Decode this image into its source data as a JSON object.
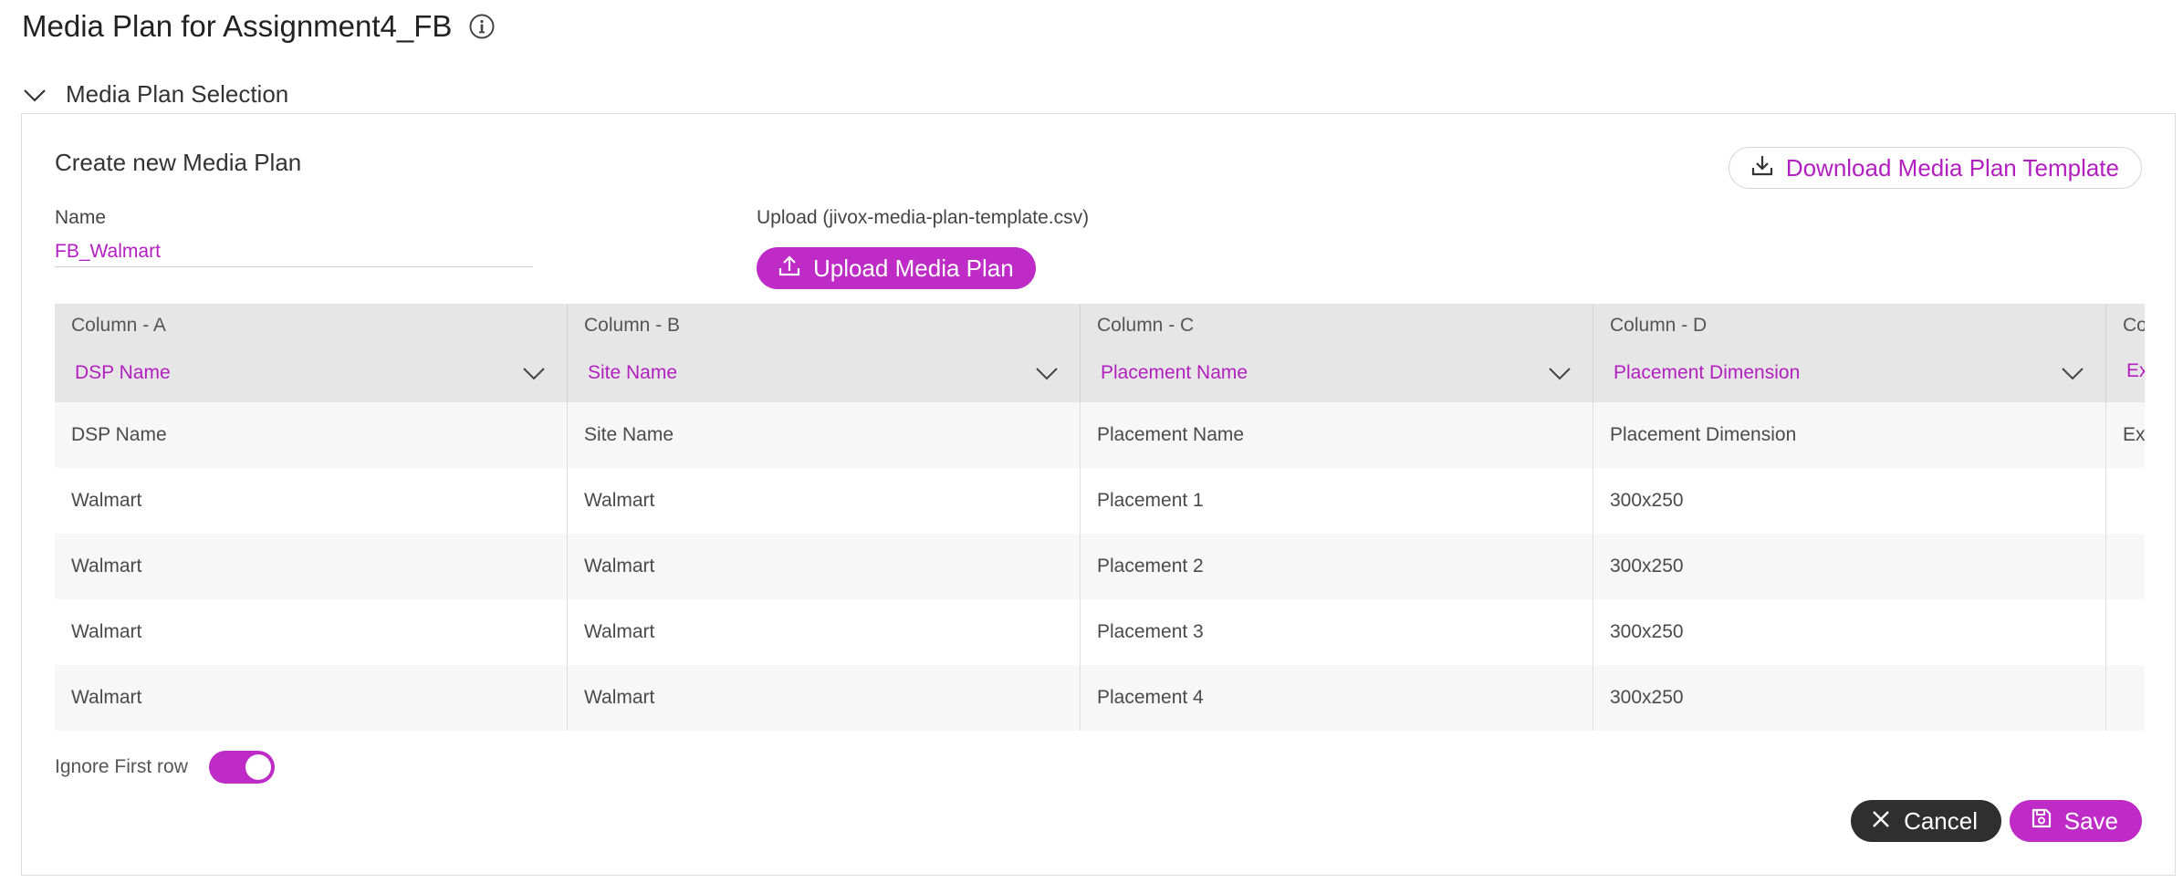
{
  "page": {
    "title": "Media Plan for Assignment4_FB",
    "info_icon": "info-icon"
  },
  "section": {
    "label": "Media Plan Selection",
    "toggle_icon": "chevron-down-icon"
  },
  "panel": {
    "create_title": "Create new Media Plan",
    "download_label": "Download Media Plan Template",
    "name_label": "Name",
    "name_value": "FB_Walmart",
    "upload_label": "Upload (jivox-media-plan-template.csv)",
    "upload_button": "Upload Media Plan"
  },
  "table": {
    "columns": [
      {
        "label": "Column - A",
        "selected": "DSP Name"
      },
      {
        "label": "Column - B",
        "selected": "Site Name"
      },
      {
        "label": "Column - C",
        "selected": "Placement Name"
      },
      {
        "label": "Column - D",
        "selected": "Placement Dimension"
      },
      {
        "label": "Co",
        "selected": "Ex"
      }
    ],
    "rows": [
      [
        "DSP Name",
        "Site Name",
        "Placement Name",
        "Placement Dimension",
        "Ext"
      ],
      [
        "Walmart",
        "Walmart",
        "Placement 1",
        "300x250",
        ""
      ],
      [
        "Walmart",
        "Walmart",
        "Placement 2",
        "300x250",
        ""
      ],
      [
        "Walmart",
        "Walmart",
        "Placement 3",
        "300x250",
        ""
      ],
      [
        "Walmart",
        "Walmart",
        "Placement 4",
        "300x250",
        ""
      ]
    ]
  },
  "footer": {
    "ignore_first_row_label": "Ignore First row",
    "ignore_first_row_on": true,
    "cancel_label": "Cancel",
    "save_label": "Save"
  },
  "colors": {
    "accent": "#be2bc7",
    "accent_text": "#b31ec0",
    "dark_button": "#2f2f2f",
    "header_bg": "#e6e6e6"
  }
}
